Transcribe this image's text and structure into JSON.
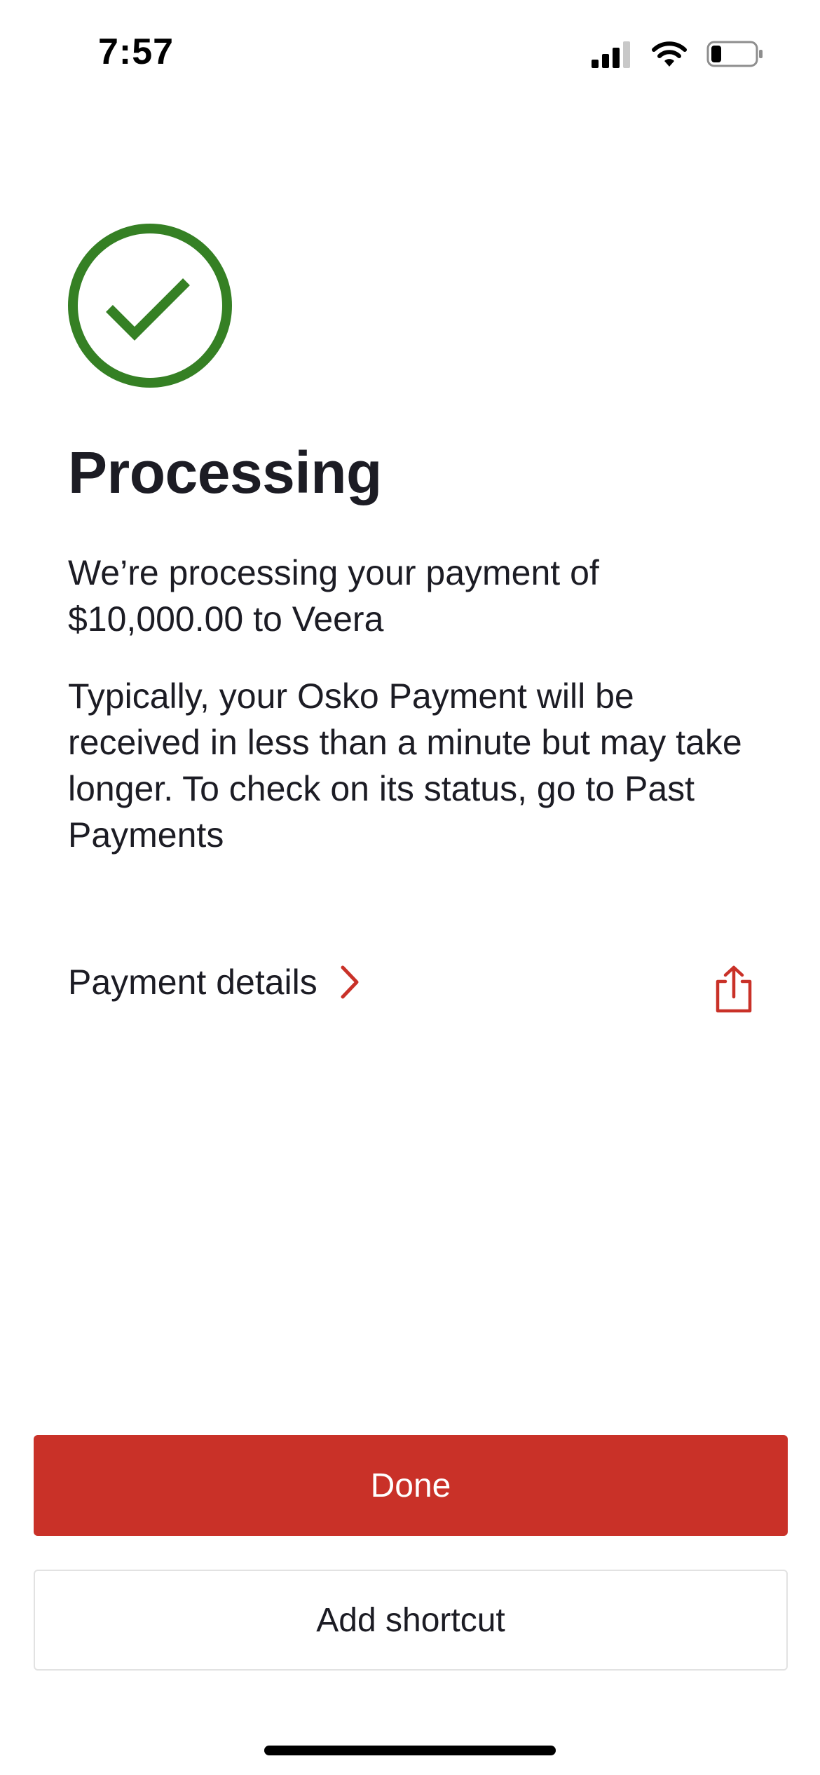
{
  "status_bar": {
    "time": "7:57",
    "icons": [
      "cellular-signal-icon",
      "wifi-icon",
      "battery-icon"
    ],
    "battery_level": 0.2
  },
  "status_icon": {
    "name": "success-checkmark-icon",
    "color": "#358024"
  },
  "title": "Processing",
  "message": "We’re processing your payment of $10,000.00 to Veera",
  "info": "Typically, your Osko Payment will be received in less than a minute but may take longer. To check on its status, go to Past Payments",
  "payment_details": {
    "label": "Payment details",
    "chevron_icon": "chevron-right-icon",
    "share_icon": "share-icon"
  },
  "actions": {
    "done_label": "Done",
    "add_shortcut_label": "Add shortcut"
  },
  "colors": {
    "accent": "#c93128",
    "success": "#358024",
    "text": "#1c1c24"
  }
}
